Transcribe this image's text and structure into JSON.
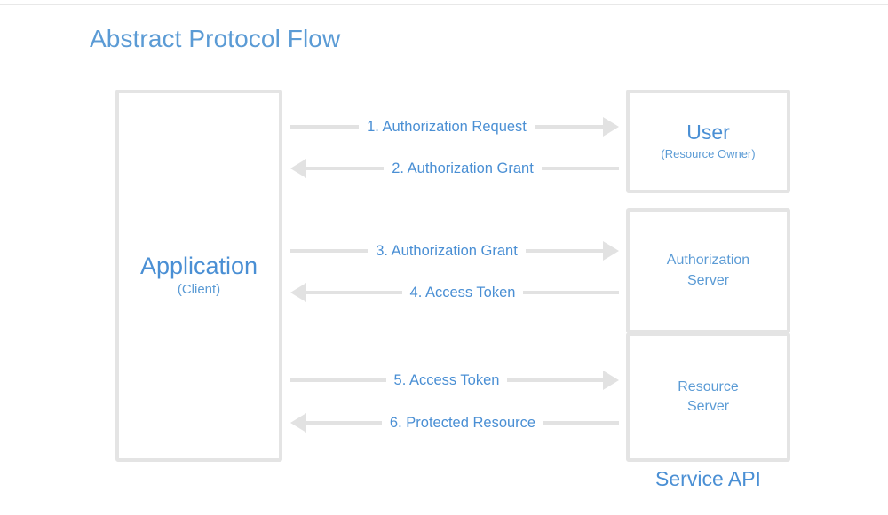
{
  "page": {
    "title": "Abstract Protocol Flow",
    "accent_color": "#4a8fd4",
    "line_color": "#e2e2e2",
    "box_border_color": "#e4e4e4",
    "background": "#ffffff"
  },
  "nodes": {
    "application": {
      "title": "Application",
      "subtitle": "(Client)"
    },
    "user": {
      "title": "User",
      "subtitle": "(Resource Owner)"
    },
    "authorization_server": {
      "line1": "Authorization",
      "line2": "Server"
    },
    "resource_server": {
      "line1": "Resource",
      "line2": "Server"
    },
    "service_api_caption": "Service API"
  },
  "flows": [
    {
      "step": "1",
      "label": "1. Authorization Request",
      "direction": "right",
      "from": "application",
      "to": "user"
    },
    {
      "step": "2",
      "label": "2. Authorization Grant",
      "direction": "left",
      "from": "user",
      "to": "application"
    },
    {
      "step": "3",
      "label": "3. Authorization Grant",
      "direction": "right",
      "from": "application",
      "to": "authorization_server"
    },
    {
      "step": "4",
      "label": "4. Access Token",
      "direction": "left",
      "from": "authorization_server",
      "to": "application"
    },
    {
      "step": "5",
      "label": "5. Access Token",
      "direction": "right",
      "from": "application",
      "to": "resource_server"
    },
    {
      "step": "6",
      "label": "6. Protected Resource",
      "direction": "left",
      "from": "resource_server",
      "to": "application"
    }
  ]
}
